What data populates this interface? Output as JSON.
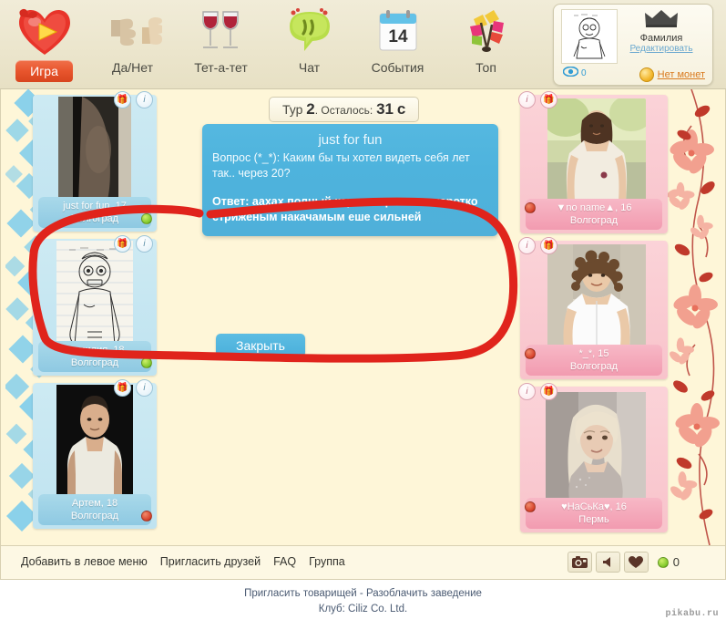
{
  "header": {
    "nav": [
      {
        "label": "Игра",
        "icon": "heart-play-icon",
        "active": true
      },
      {
        "label": "Да/Нет",
        "icon": "thumbs-up-down-icon",
        "active": false
      },
      {
        "label": "Тет-а-тет",
        "icon": "wine-glasses-icon",
        "active": false
      },
      {
        "label": "Чат",
        "icon": "speech-bubble-icon",
        "active": false
      },
      {
        "label": "События",
        "icon": "calendar-icon",
        "active": false,
        "calendar_day": "14"
      },
      {
        "label": "Топ",
        "icon": "flowers-bouquet-icon",
        "active": false
      }
    ],
    "profile": {
      "avatar_icon": "user-drawing-avatar",
      "crown_icon": "crown-icon",
      "name": "Фамилия",
      "edit_label": "Редактировать",
      "eye_icon": "eye-icon",
      "views_count": "0",
      "coin_icon": "coin-icon",
      "coins_label": "Нет монет"
    }
  },
  "main": {
    "timer": {
      "round_prefix": "Тур",
      "round_number": "2",
      "remaining_label": ". Осталось:",
      "remaining_value": "31",
      "remaining_unit": "с"
    },
    "dialog": {
      "title": "just for fun",
      "question": "Вопрос (*_*): Каким бы ты хотел видеть себя лет так.. через 20?",
      "answer": "Ответ: аахах полный карман презиков  коротко стриженым накачамым еше сильней",
      "close_label": "Закрыть"
    },
    "left_cards": [
      {
        "name": "just for fun, 17",
        "city": "Волгоград",
        "status": "online",
        "badges": [
          "gift-icon",
          "info-icon"
        ],
        "photo": "man-torso-photo"
      },
      {
        "name": "Фамилия, 18",
        "city": "Волгоград",
        "status": "online",
        "badges": [
          "gift-icon",
          "info-icon"
        ],
        "photo": "hand-drawing-photo"
      },
      {
        "name": "Артем, 18",
        "city": "Волгоград",
        "status": "offline",
        "badges": [
          "gift-icon",
          "info-icon"
        ],
        "photo": "young-man-photo"
      }
    ],
    "right_cards": [
      {
        "name": "▼no name▲, 16",
        "city": "Волгоград",
        "status": "offline",
        "badges": [
          "info-icon",
          "gift-icon"
        ],
        "photo": "girl-outdoors-photo"
      },
      {
        "name": "*_*, 15",
        "city": "Волгоград",
        "status": "offline",
        "badges": [
          "info-icon",
          "gift-icon"
        ],
        "photo": "curly-girl-photo"
      },
      {
        "name": "♥НаСьКа♥, 16",
        "city": "Пермь",
        "status": "offline",
        "badges": [
          "info-icon",
          "gift-icon"
        ],
        "photo": "blonde-girl-photo"
      }
    ]
  },
  "footer": {
    "links": [
      "Добавить в левое меню",
      "Пригласить друзей",
      "FAQ",
      "Группа"
    ],
    "tools": [
      {
        "icon": "camera-icon"
      },
      {
        "icon": "speaker-icon"
      },
      {
        "icon": "heart-icon"
      }
    ],
    "online_dot_icon": "green-dot-icon",
    "online_count": "0"
  },
  "bottom": {
    "line1": "Пригласить товарищей - Разоблачить заведение",
    "line2": "Клуб: Ciliz Co. Ltd.",
    "watermark": "pikabu.ru"
  },
  "colors": {
    "accent_orange": "#e8552d",
    "page_bg": "#fef6d8",
    "header_bg": "#ebe5cc",
    "dialog_blue": "#4eb3dd",
    "card_blue": "#bfe3f0",
    "card_pink": "#f8c3cb",
    "annotation_red": "#e0241c"
  }
}
